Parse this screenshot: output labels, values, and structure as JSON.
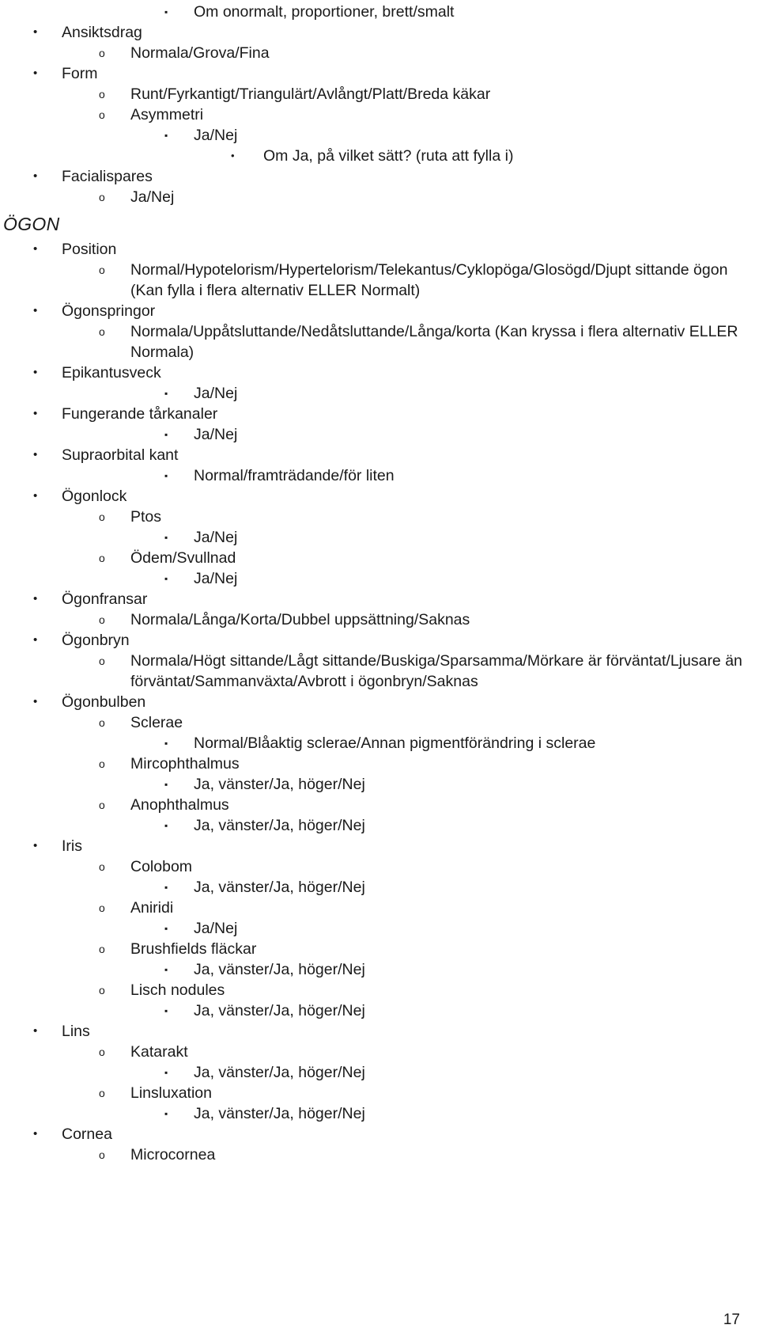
{
  "document": {
    "page_number": "17",
    "bullets": {
      "level1": "•",
      "level2": "o",
      "level3": "▪",
      "level4": "•"
    },
    "text_color": "#1a1a1a",
    "background_color": "#ffffff"
  },
  "sections": [
    {
      "heading": null,
      "items": [
        {
          "level": 3,
          "text": "Om onormalt, proportioner, brett/smalt"
        },
        {
          "level": 1,
          "text": "Ansiktsdrag"
        },
        {
          "level": 2,
          "text": "Normala/Grova/Fina"
        },
        {
          "level": 1,
          "text": "Form"
        },
        {
          "level": 2,
          "text": "Runt/Fyrkantigt/Triangulärt/Avlångt/Platt/Breda käkar"
        },
        {
          "level": 2,
          "text": "Asymmetri"
        },
        {
          "level": 3,
          "text": "Ja/Nej"
        },
        {
          "level": 4,
          "text": "Om Ja, på vilket sätt? (ruta att fylla i)"
        },
        {
          "level": 1,
          "text": "Facialispares"
        },
        {
          "level": 2,
          "text": "Ja/Nej"
        }
      ]
    },
    {
      "heading": "ÖGON",
      "items": [
        {
          "level": 1,
          "text": "Position"
        },
        {
          "level": 2,
          "text": "Normal/Hypotelorism/Hypertelorism/Telekantus/Cyklopöga/Glosögd/Djupt sittande ögon (Kan fylla i flera alternativ ELLER Normalt)"
        },
        {
          "level": 1,
          "text": "Ögonspringor"
        },
        {
          "level": 2,
          "text": "Normala/Uppåtsluttande/Nedåtsluttande/Långa/korta (Kan kryssa i flera alternativ ELLER Normala)"
        },
        {
          "level": 1,
          "text": "Epikantusveck"
        },
        {
          "level": 3,
          "text": "Ja/Nej"
        },
        {
          "level": 1,
          "text": "Fungerande tårkanaler"
        },
        {
          "level": 3,
          "text": "Ja/Nej"
        },
        {
          "level": 1,
          "text": "Supraorbital kant"
        },
        {
          "level": 3,
          "text": "Normal/framträdande/för liten"
        },
        {
          "level": 1,
          "text": "Ögonlock"
        },
        {
          "level": 2,
          "text": "Ptos"
        },
        {
          "level": 3,
          "text": "Ja/Nej"
        },
        {
          "level": 2,
          "text": "Ödem/Svullnad"
        },
        {
          "level": 3,
          "text": "Ja/Nej"
        },
        {
          "level": 1,
          "text": "Ögonfransar"
        },
        {
          "level": 2,
          "text": "Normala/Långa/Korta/Dubbel uppsättning/Saknas"
        },
        {
          "level": 1,
          "text": "Ögonbryn"
        },
        {
          "level": 2,
          "text": "Normala/Högt sittande/Lågt sittande/Buskiga/Sparsamma/Mörkare är förväntat/Ljusare än förväntat/Sammanväxta/Avbrott i ögonbryn/Saknas"
        },
        {
          "level": 1,
          "text": "Ögonbulben"
        },
        {
          "level": 2,
          "text": "Sclerae"
        },
        {
          "level": 3,
          "text": "Normal/Blåaktig sclerae/Annan pigmentförändring i sclerae"
        },
        {
          "level": 2,
          "text": "Mircophthalmus"
        },
        {
          "level": 3,
          "text": "Ja, vänster/Ja, höger/Nej"
        },
        {
          "level": 2,
          "text": "Anophthalmus"
        },
        {
          "level": 3,
          "text": "Ja, vänster/Ja, höger/Nej"
        },
        {
          "level": 1,
          "text": "Iris"
        },
        {
          "level": 2,
          "text": "Colobom"
        },
        {
          "level": 3,
          "text": "Ja, vänster/Ja, höger/Nej"
        },
        {
          "level": 2,
          "text": "Aniridi"
        },
        {
          "level": 3,
          "text": "Ja/Nej"
        },
        {
          "level": 2,
          "text": "Brushfields fläckar"
        },
        {
          "level": 3,
          "text": "Ja, vänster/Ja, höger/Nej"
        },
        {
          "level": 2,
          "text": "Lisch nodules"
        },
        {
          "level": 3,
          "text": "Ja, vänster/Ja, höger/Nej"
        },
        {
          "level": 1,
          "text": "Lins"
        },
        {
          "level": 2,
          "text": "Katarakt"
        },
        {
          "level": 3,
          "text": "Ja, vänster/Ja, höger/Nej"
        },
        {
          "level": 2,
          "text": "Linsluxation"
        },
        {
          "level": 3,
          "text": "Ja, vänster/Ja, höger/Nej"
        },
        {
          "level": 1,
          "text": "Cornea"
        },
        {
          "level": 2,
          "text": "Microcornea"
        }
      ]
    }
  ]
}
